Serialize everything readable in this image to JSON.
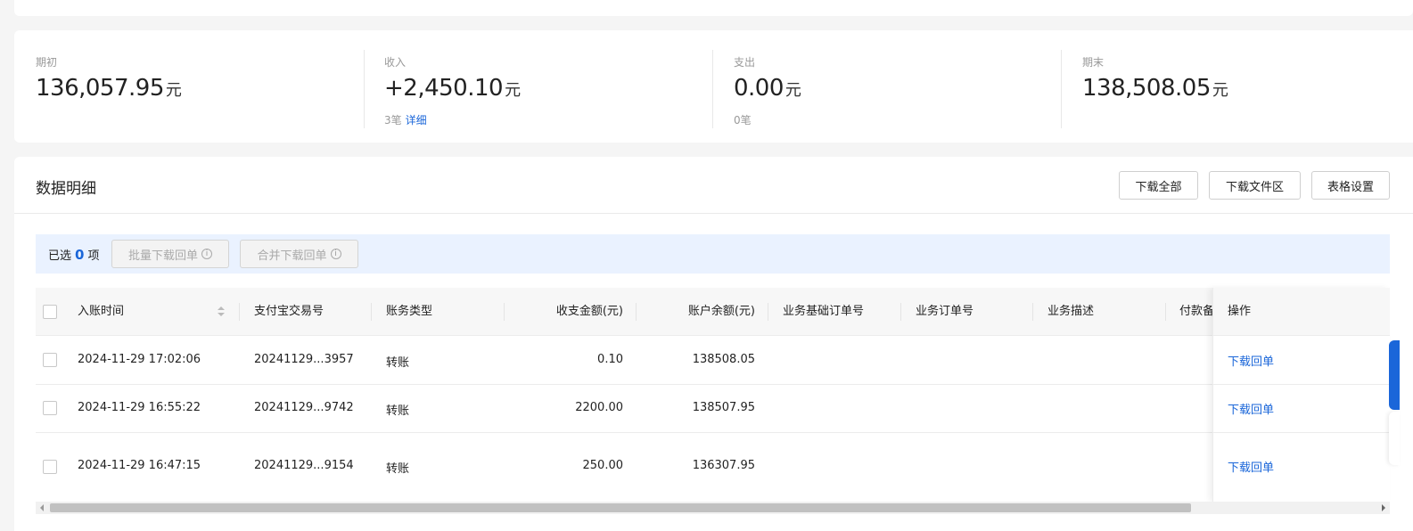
{
  "summary": {
    "opening": {
      "label": "期初",
      "value": "136,057.95",
      "unit": "元"
    },
    "income": {
      "label": "收入",
      "value": "+2,450.10",
      "unit": "元",
      "count": "3笔",
      "detail_link": "详细"
    },
    "expense": {
      "label": "支出",
      "value": "0.00",
      "unit": "元",
      "count": "0笔"
    },
    "closing": {
      "label": "期末",
      "value": "138,508.05",
      "unit": "元"
    }
  },
  "detail": {
    "title": "数据明细",
    "buttons": {
      "download_all": "下载全部",
      "download_files": "下载文件区",
      "table_settings": "表格设置"
    }
  },
  "selection": {
    "prefix": "已选",
    "count": "0",
    "suffix": "项",
    "batch_download": "批量下载回单",
    "merge_download": "合并下载回单"
  },
  "table": {
    "columns": {
      "time": "入账时间",
      "trade_no": "支付宝交易号",
      "type": "账务类型",
      "amount": "收支金额(元)",
      "balance": "账户余额(元)",
      "base_order": "业务基础订单号",
      "order": "业务订单号",
      "desc": "业务描述",
      "remark": "付款备",
      "ops": "操作"
    },
    "rows": [
      {
        "time": "2024-11-29 17:02:06",
        "trade_no": "20241129...3957",
        "type": "转账",
        "amount": "0.10",
        "balance": "138508.05",
        "op": "下载回单"
      },
      {
        "time": "2024-11-29 16:55:22",
        "trade_no": "20241129...9742",
        "type": "转账",
        "amount": "2200.00",
        "balance": "138507.95",
        "op": "下载回单"
      },
      {
        "time": "2024-11-29 16:47:15",
        "trade_no": "20241129...9154",
        "type": "转账",
        "amount": "250.00",
        "balance": "136307.95",
        "op": "下载回单"
      }
    ]
  },
  "colors": {
    "accent": "#1a66d9",
    "selection_bg": "#eaf2ff"
  }
}
